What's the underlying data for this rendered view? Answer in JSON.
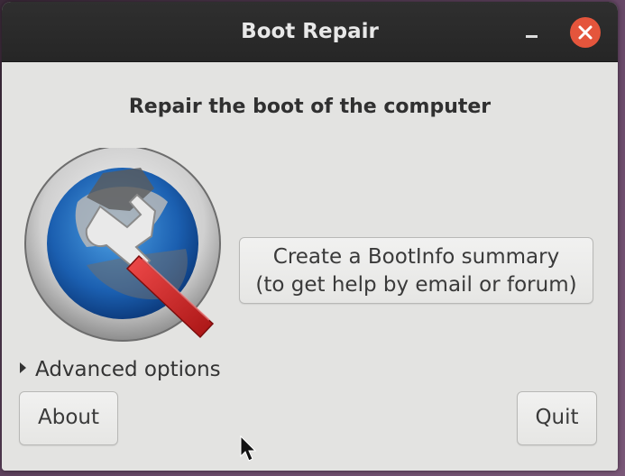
{
  "window": {
    "title": "Boot Repair",
    "minimize_icon": "minimize-icon",
    "close_icon": "close-icon",
    "colors": {
      "titlebar": "#2b2b2b",
      "close_button": "#e4553c",
      "background": "#e3e3e1"
    }
  },
  "main": {
    "heading": "Repair the boot of the computer",
    "logo_icon": "boot-repair-wrench-logo",
    "bootinfo_button": {
      "line1": "Create a BootInfo summary",
      "line2": "(to get help by email or forum)"
    },
    "advanced_options_label": "Advanced options"
  },
  "footer": {
    "about_label": "About",
    "quit_label": "Quit"
  }
}
